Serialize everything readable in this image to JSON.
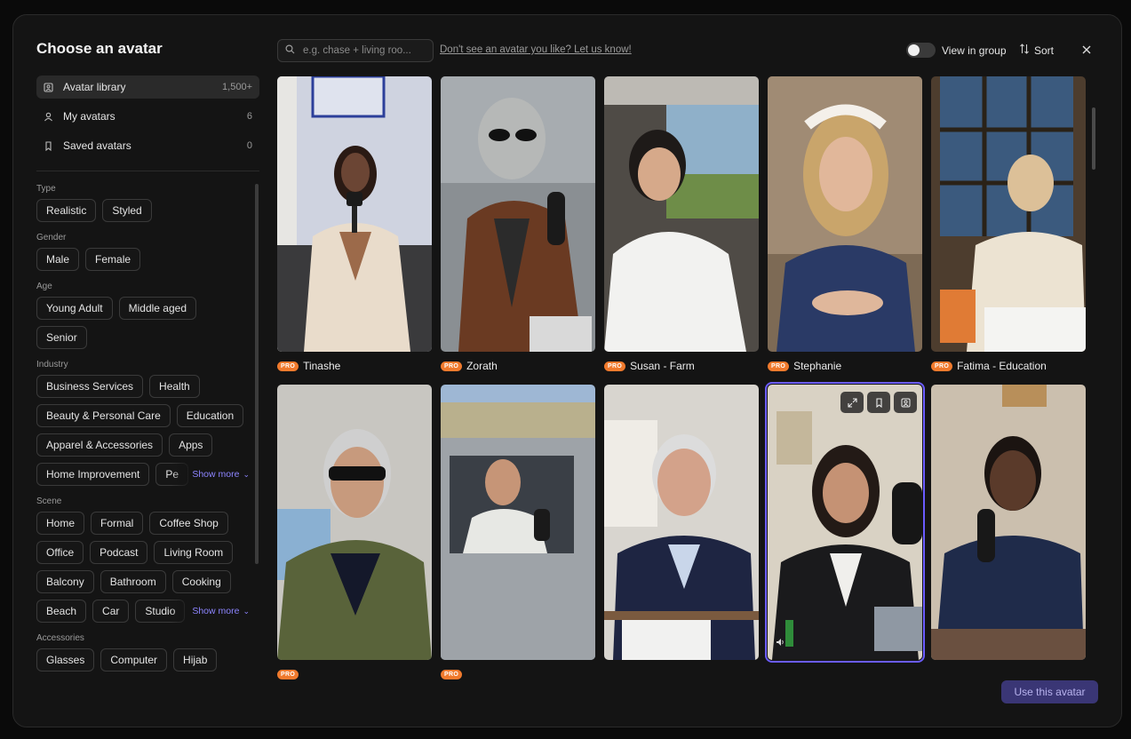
{
  "modal": {
    "title": "Choose an avatar"
  },
  "library_nav": [
    {
      "icon": "library-icon",
      "label": "Avatar library",
      "count": "1,500+",
      "active": true
    },
    {
      "icon": "user-icon",
      "label": "My avatars",
      "count": "6",
      "active": false
    },
    {
      "icon": "bookmark-icon",
      "label": "Saved avatars",
      "count": "0",
      "active": false
    }
  ],
  "filters": {
    "type": {
      "label": "Type",
      "options": [
        "Realistic",
        "Styled"
      ]
    },
    "gender": {
      "label": "Gender",
      "options": [
        "Male",
        "Female"
      ]
    },
    "age": {
      "label": "Age",
      "options": [
        "Young Adult",
        "Middle aged",
        "Senior"
      ]
    },
    "industry": {
      "label": "Industry",
      "options": [
        "Business Services",
        "Health",
        "Beauty & Personal Care",
        "Education",
        "Apparel & Accessories",
        "Apps"
      ],
      "clipped_row": [
        "Home Improvement",
        "Pe"
      ],
      "show_more": "Show more"
    },
    "scene": {
      "label": "Scene",
      "options": [
        "Home",
        "Formal",
        "Coffee Shop",
        "Office",
        "Podcast",
        "Living Room",
        "Balcony",
        "Bathroom",
        "Cooking"
      ],
      "clipped_row": [
        "Beach",
        "Car",
        "Studio"
      ],
      "show_more": "Show more"
    },
    "accessories": {
      "label": "Accessories",
      "options": [
        "Glasses",
        "Computer",
        "Hijab"
      ]
    }
  },
  "search": {
    "placeholder": "e.g. chase + living roo..."
  },
  "hint_link": "Don't see an avatar you like? Let us know!",
  "toolbar": {
    "view_in_group": "View in group",
    "view_in_group_on": false,
    "sort_label": "Sort",
    "close_icon": "close-icon"
  },
  "pro_badge": "PRO",
  "avatars": [
    {
      "name": "Tinashe",
      "pro": true
    },
    {
      "name": "Zorath",
      "pro": true
    },
    {
      "name": "Susan - Farm",
      "pro": true
    },
    {
      "name": "Stephanie",
      "pro": true
    },
    {
      "name": "Fatima - Education",
      "pro": true
    },
    {
      "name": "",
      "pro": true
    },
    {
      "name": "",
      "pro": true
    },
    {
      "name": "",
      "pro": false
    },
    {
      "name": "",
      "pro": false,
      "selected": true
    },
    {
      "name": "",
      "pro": true
    }
  ],
  "hover_actions": [
    "expand-icon",
    "bookmark-icon",
    "group-icon"
  ],
  "use_button": "Use this avatar"
}
